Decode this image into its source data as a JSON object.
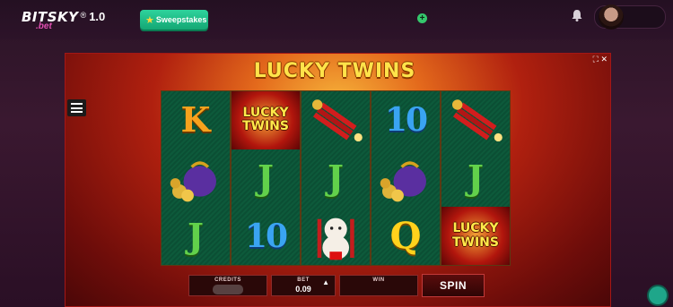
{
  "header": {
    "logo_main": "BITSKY",
    "logo_sub": ".bet",
    "logo_reg": "®",
    "version": "1.0",
    "sweepstakes_label": "Sweepstakes",
    "plus_symbol": "+",
    "icons": [
      "star-icon",
      "plus-icon",
      "bell-icon",
      "avatar"
    ]
  },
  "game": {
    "title": "LUCKY TWINS",
    "top_icons": "⛶ ✕",
    "reels": [
      [
        {
          "type": "K",
          "label": "K"
        },
        {
          "type": "coin-bag"
        },
        {
          "type": "J",
          "label": "J"
        }
      ],
      [
        {
          "type": "wild",
          "label": "LUCKY\nTWINS"
        },
        {
          "type": "J",
          "label": "J"
        },
        {
          "type": "10",
          "label": "10"
        }
      ],
      [
        {
          "type": "firecracker"
        },
        {
          "type": "J",
          "label": "J"
        },
        {
          "type": "lucky-cat"
        }
      ],
      [
        {
          "type": "10",
          "label": "10"
        },
        {
          "type": "coin-bag"
        },
        {
          "type": "Q",
          "label": "Q"
        }
      ],
      [
        {
          "type": "firecracker"
        },
        {
          "type": "J",
          "label": "J"
        },
        {
          "type": "wild",
          "label": "LUCKY\nTWINS"
        }
      ]
    ]
  },
  "controls": {
    "credits_label": "CREDITS",
    "bet_label": "BET",
    "bet_value": "0.09",
    "bet_arrow": "▲",
    "win_label": "WIN",
    "win_value": "",
    "spin_label": "SPIN"
  },
  "colors": {
    "sweepstakes_green": "#14a774",
    "title_yellow": "#ffe34a",
    "reel_green": "#0d5a3b",
    "frame_red": "#b0200f"
  }
}
